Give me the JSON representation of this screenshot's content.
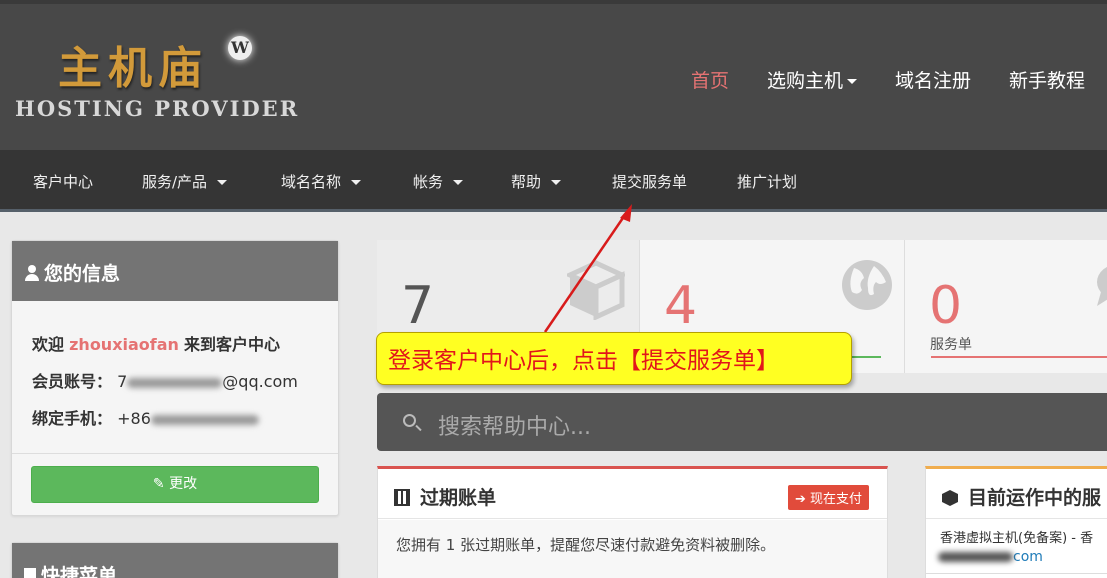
{
  "header": {
    "logo_cn": "主机庙",
    "logo_wp": "W",
    "logo_en": "HOSTING PROVIDER",
    "nav": [
      {
        "label": "首页"
      },
      {
        "label": "选购主机"
      },
      {
        "label": "域名注册"
      },
      {
        "label": "新手教程"
      }
    ]
  },
  "subnav": [
    {
      "label": "客户中心"
    },
    {
      "label": "服务/产品"
    },
    {
      "label": "域名名称"
    },
    {
      "label": "帐务"
    },
    {
      "label": "帮助"
    },
    {
      "label": "提交服务单"
    },
    {
      "label": "推广计划"
    }
  ],
  "info_panel": {
    "title": "您的信息",
    "welcome_prefix": "欢迎",
    "username": "zhouxiaofan",
    "welcome_suffix": "来到客户中心",
    "account_label": "会员账号：",
    "account_value_visible": "7",
    "account_value_suffix": "@qq.com",
    "phone_label": "绑定手机：",
    "phone_value_visible": "+86",
    "edit_label": "更改"
  },
  "quick_panel": {
    "title": "快捷菜单"
  },
  "stats": [
    {
      "value": "7",
      "label": "",
      "color": "#555555",
      "icon": "cube-icon"
    },
    {
      "value": "4",
      "label": "",
      "color": "#e57373",
      "icon": "globe-icon"
    },
    {
      "value": "0",
      "label": "服务单",
      "color": "#e57373",
      "icon": "comment-icon"
    }
  ],
  "search": {
    "placeholder": "搜索帮助中心..."
  },
  "invoice_card": {
    "title": "过期账单",
    "button": "现在支付",
    "text": "您拥有 1 张过期账单，提醒您尽速付款避免资料被删除。"
  },
  "service_card": {
    "title": "目前运作中的服",
    "item_line1": "香港虚拟主机(免备案) - 香",
    "item_line2_suffix": "com"
  },
  "callout": {
    "text": "登录客户中心后，点击【提交服务单】"
  },
  "colors": {
    "accent_red": "#e57373",
    "green": "#5cb85c",
    "callout_yellow": "#ffff22"
  }
}
